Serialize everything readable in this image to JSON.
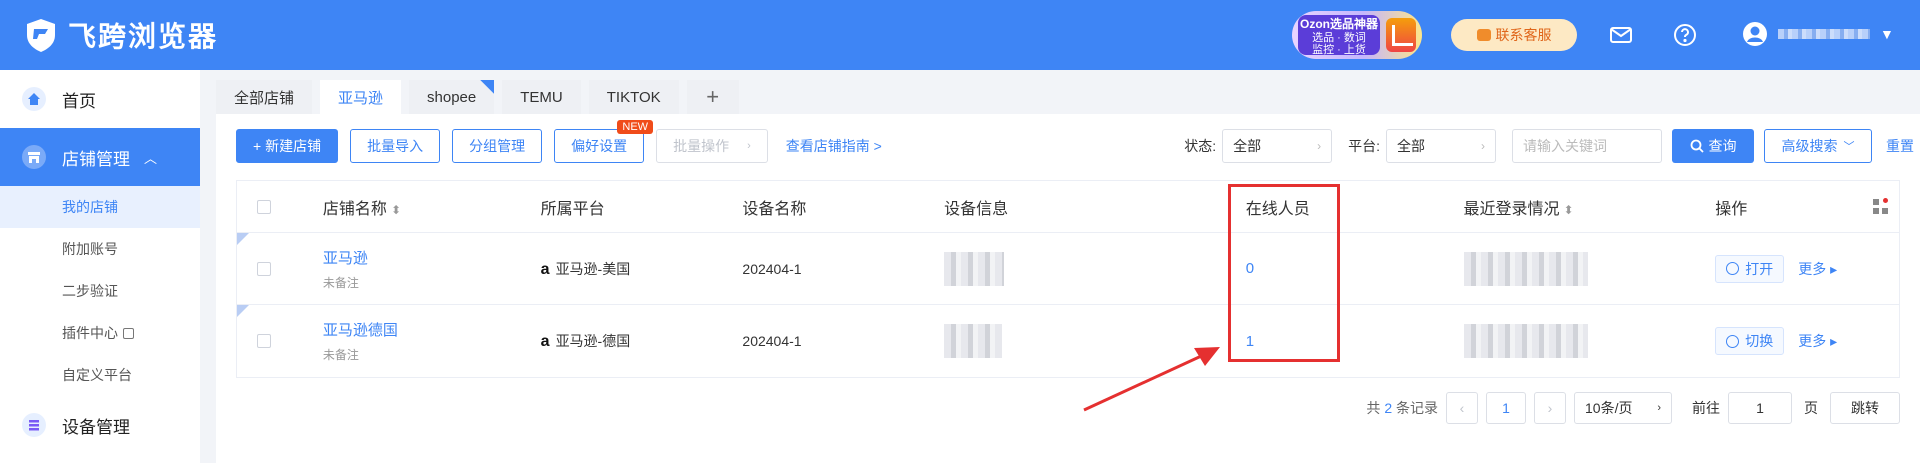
{
  "header": {
    "app_title": "飞跨浏览器",
    "ozon_badge": {
      "title": "Ozon选品神器",
      "line1": "选品 · 数词",
      "line2": "监控 · 上货"
    },
    "contact_label": "联系客服",
    "brand_color": "#3e85f5"
  },
  "sidebar": {
    "home": "首页",
    "store_mgmt": "店铺管理",
    "sub_items": [
      "我的店铺",
      "附加账号",
      "二步验证",
      "插件中心",
      "自定义平台"
    ],
    "device_mgmt": "设备管理"
  },
  "tabs": [
    "全部店铺",
    "亚马逊",
    "shopee",
    "TEMU",
    "TIKTOK",
    "+"
  ],
  "toolbar": {
    "new_store": "+ 新建店铺",
    "batch_import": "批量导入",
    "group_mgmt": "分组管理",
    "preference": "偏好设置",
    "new_badge": "NEW",
    "batch_ops": "批量操作",
    "guide": "查看店铺指南 >"
  },
  "filters": {
    "status_label": "状态:",
    "status_value": "全部",
    "platform_label": "平台:",
    "platform_value": "全部",
    "keyword_placeholder": "请输入关键词",
    "query": "查询",
    "advanced": "高级搜索",
    "reset": "重置"
  },
  "table": {
    "headers": [
      "店铺名称",
      "所属平台",
      "设备名称",
      "设备信息",
      "在线人员",
      "最近登录情况",
      "操作"
    ],
    "rows": [
      {
        "name": "亚马逊",
        "remark": "未备注",
        "platform": "亚马逊-美国",
        "device": "202404-1",
        "online": "0",
        "action": "打开",
        "more": "更多 ▸"
      },
      {
        "name": "亚马逊德国",
        "remark": "未备注",
        "platform": "亚马逊-德国",
        "device": "202404-1",
        "online": "1",
        "action": "切换",
        "more": "更多 ▸"
      }
    ]
  },
  "pager": {
    "total_prefix": "共",
    "total": "2",
    "total_suffix": "条记录",
    "current": "1",
    "page_size": "10条/页",
    "goto_label": "前往",
    "goto_value": "1",
    "page_unit": "页",
    "jump": "跳转"
  },
  "annotation_color": "#e53030"
}
